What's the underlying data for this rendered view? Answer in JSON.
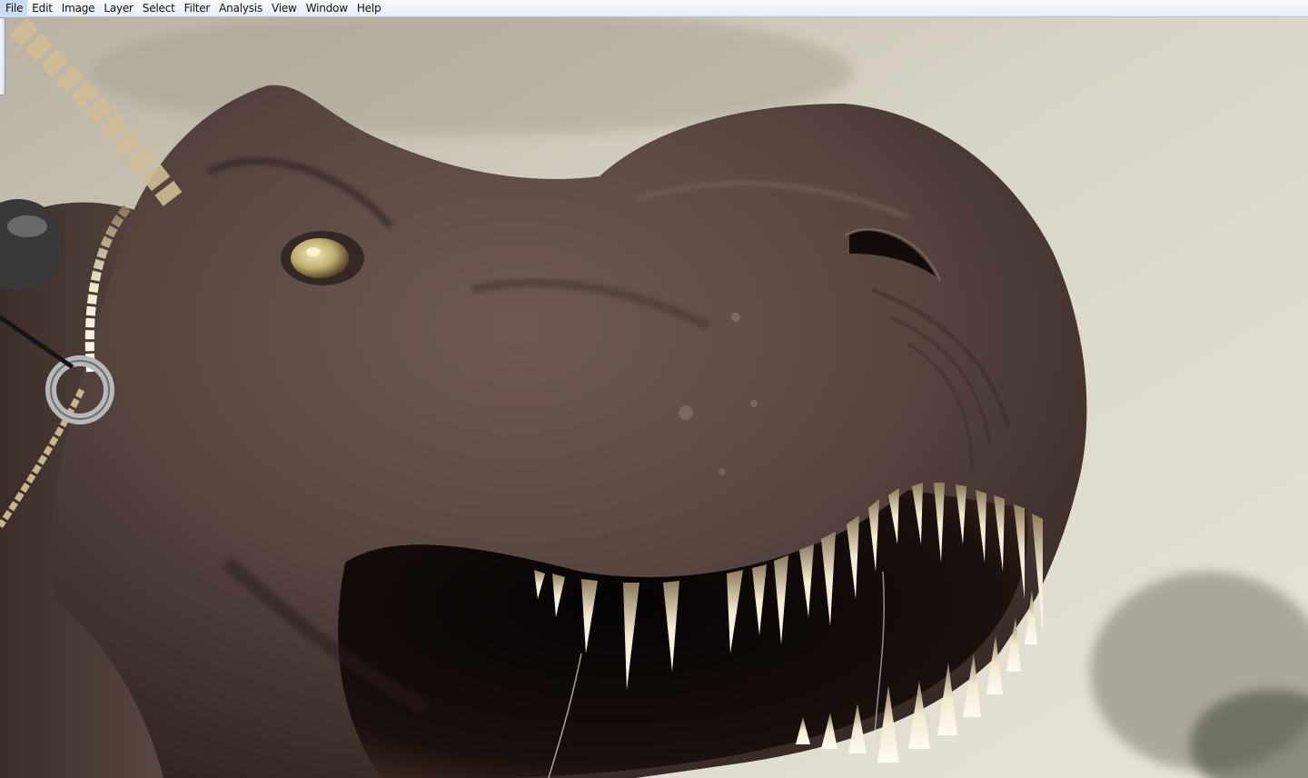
{
  "menubar": {
    "items": [
      {
        "id": "file",
        "label": "File"
      },
      {
        "id": "edit",
        "label": "Edit"
      },
      {
        "id": "image",
        "label": "Image"
      },
      {
        "id": "layer",
        "label": "Layer"
      },
      {
        "id": "select",
        "label": "Select"
      },
      {
        "id": "filter",
        "label": "Filter"
      },
      {
        "id": "analysis",
        "label": "Analysis"
      },
      {
        "id": "view",
        "label": "View"
      },
      {
        "id": "window",
        "label": "Window"
      },
      {
        "id": "help",
        "label": "Help"
      }
    ]
  },
  "canvas": {
    "subject": "dinosaur-illustration",
    "colors": {
      "sky": "#dcd8c8",
      "skin": "#5a4640",
      "skin_shadow": "#3a2c28",
      "mouth": "#120c0a",
      "teeth": "#efe2c0",
      "eye": "#c9b878",
      "rope": "#c8b48a"
    }
  }
}
